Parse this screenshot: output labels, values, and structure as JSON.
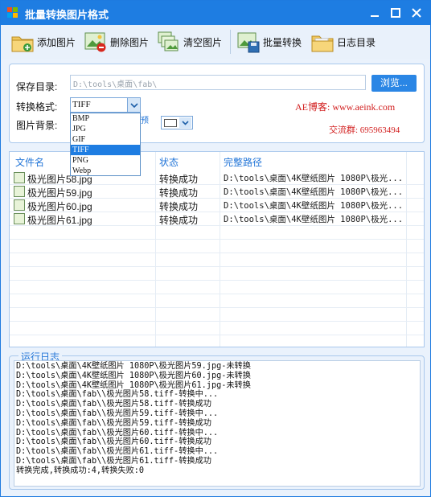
{
  "window": {
    "title": "批量转换图片格式"
  },
  "toolbar": {
    "add": "添加图片",
    "remove": "删除图片",
    "clear": "清空图片",
    "convert": "批量转换",
    "log_dir": "日志目录"
  },
  "settings": {
    "save_dir_label": "保存目录:",
    "save_dir_value": "D:\\tools\\桌面\\fab\\",
    "browse_label": "浏览...",
    "format_label": "转换格式:",
    "format_value": "TIFF",
    "format_options": [
      "BMP",
      "JPG",
      "GIF",
      "TIFF",
      "PNG",
      "Webp"
    ],
    "format_selected": "TIFF",
    "bg_label": "图片背景:",
    "bg_color": "#ffffff",
    "partial_text": "预"
  },
  "promo": {
    "blog": "AE博客: www.aeink.com",
    "group": "交流群: 695963494"
  },
  "table": {
    "headers": [
      "文件名",
      "状态",
      "完整路径"
    ],
    "rows": [
      {
        "name": "极光图片58.jpg",
        "status": "转换成功",
        "path": "D:\\tools\\桌面\\4K壁纸图片 1080P\\极光..."
      },
      {
        "name": "极光图片59.jpg",
        "status": "转换成功",
        "path": "D:\\tools\\桌面\\4K壁纸图片 1080P\\极光..."
      },
      {
        "name": "极光图片60.jpg",
        "status": "转换成功",
        "path": "D:\\tools\\桌面\\4K壁纸图片 1080P\\极光..."
      },
      {
        "name": "极光图片61.jpg",
        "status": "转换成功",
        "path": "D:\\tools\\桌面\\4K壁纸图片 1080P\\极光..."
      }
    ]
  },
  "log": {
    "title": "运行日志",
    "lines": [
      "D:\\tools\\桌面\\4K壁纸图片 1080P\\极光图片59.jpg-未转换",
      "D:\\tools\\桌面\\4K壁纸图片 1080P\\极光图片60.jpg-未转换",
      "D:\\tools\\桌面\\4K壁纸图片 1080P\\极光图片61.jpg-未转换",
      "D:\\tools\\桌面\\fab\\\\极光图片58.tiff-转换中...",
      "D:\\tools\\桌面\\fab\\\\极光图片58.tiff-转换成功",
      "D:\\tools\\桌面\\fab\\\\极光图片59.tiff-转换中...",
      "D:\\tools\\桌面\\fab\\\\极光图片59.tiff-转换成功",
      "D:\\tools\\桌面\\fab\\\\极光图片60.tiff-转换中...",
      "D:\\tools\\桌面\\fab\\\\极光图片60.tiff-转换成功",
      "D:\\tools\\桌面\\fab\\\\极光图片61.tiff-转换中...",
      "D:\\tools\\桌面\\fab\\\\极光图片61.tiff-转换成功",
      "转换完成,转换成功:4,转换失败:0"
    ]
  },
  "icons": {
    "add": "folder-add-icon",
    "remove": "image-remove-icon",
    "clear": "images-clear-icon",
    "convert": "batch-convert-icon",
    "log_dir": "folder-icon"
  },
  "colors": {
    "accent": "#1e7de2",
    "promo": "#d21f1f",
    "header": "#2577d8"
  }
}
